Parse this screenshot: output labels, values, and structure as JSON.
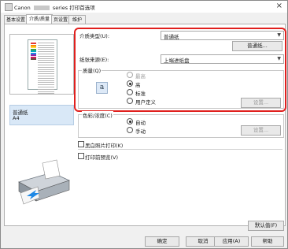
{
  "window": {
    "title_prefix": "Canon",
    "title_suffix": "series 打印首选项",
    "close_glyph": "×"
  },
  "tabs": [
    {
      "label": "基本设置",
      "active": false
    },
    {
      "label": "介质/质量",
      "active": true
    },
    {
      "label": "页设置",
      "active": false
    },
    {
      "label": "维护",
      "active": false
    }
  ],
  "preview": {
    "media_name": "普通纸",
    "media_size": "A4"
  },
  "media_type": {
    "label": "介质类型(U):",
    "value": "普通纸",
    "details_button": "普通纸..."
  },
  "paper_source": {
    "label": "纸张来源(E):",
    "value": "上端进纸盘"
  },
  "quality": {
    "label": "质量(Q)",
    "icon_letter": "a",
    "options": [
      {
        "label": "最高",
        "selected": false,
        "enabled": false
      },
      {
        "label": "高",
        "selected": true,
        "enabled": true
      },
      {
        "label": "标准",
        "selected": false,
        "enabled": true
      },
      {
        "label": "用户定义",
        "selected": false,
        "enabled": true
      }
    ],
    "settings_button": "设置..."
  },
  "color": {
    "label": "色彩/浓度(C)",
    "options": [
      {
        "label": "自动",
        "selected": true
      },
      {
        "label": "手动",
        "selected": false
      }
    ],
    "settings_button": "设置..."
  },
  "grayscale": {
    "label": "黑白照片打印(K)",
    "checked": false
  },
  "preview_before_print": {
    "label": "打印前预览(V)",
    "checked": false
  },
  "defaults_button": "默认值(F)",
  "footer": {
    "ok": "确定",
    "cancel": "取消",
    "apply": "应用(A)",
    "help": "帮助"
  },
  "colors": {
    "highlight": "#e0201e",
    "selection": "#d9e8f7"
  }
}
